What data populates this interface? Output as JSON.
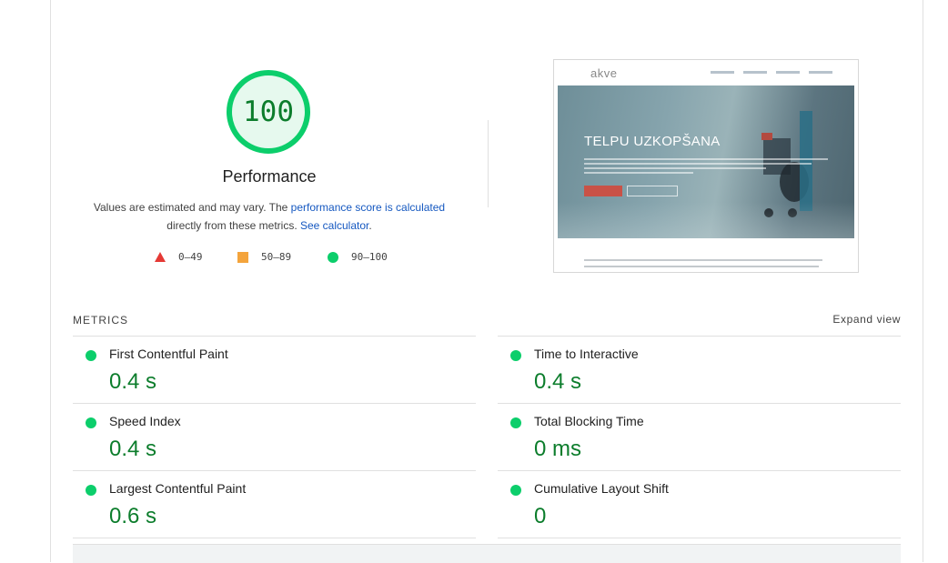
{
  "gauge": {
    "score": "100",
    "score_fraction": 1.0,
    "label": "Performance",
    "color": "#0cce6b"
  },
  "description": {
    "text_before": "Values are estimated and may vary. The ",
    "link_score": "performance score is calculated",
    "text_middle": "directly from these metrics. ",
    "link_calculator": "See calculator",
    "text_after": "."
  },
  "legend": [
    {
      "range": "0–49",
      "shape": "triangle",
      "color": "#e53935"
    },
    {
      "range": "50–89",
      "shape": "square",
      "color": "#f4a43c"
    },
    {
      "range": "90–100",
      "shape": "circle",
      "color": "#0cce6b"
    }
  ],
  "screenshot": {
    "logo_text": "akve",
    "hero_title": "TELPU UZKOPŠANA"
  },
  "metrics": {
    "header": "METRICS",
    "expand_label": "Expand view",
    "items": [
      {
        "title": "First Contentful Paint",
        "value": "0.4 s"
      },
      {
        "title": "Time to Interactive",
        "value": "0.4 s"
      },
      {
        "title": "Speed Index",
        "value": "0.4 s"
      },
      {
        "title": "Total Blocking Time",
        "value": "0 ms"
      },
      {
        "title": "Largest Contentful Paint",
        "value": "0.6 s"
      },
      {
        "title": "Cumulative Layout Shift",
        "value": "0"
      }
    ]
  }
}
